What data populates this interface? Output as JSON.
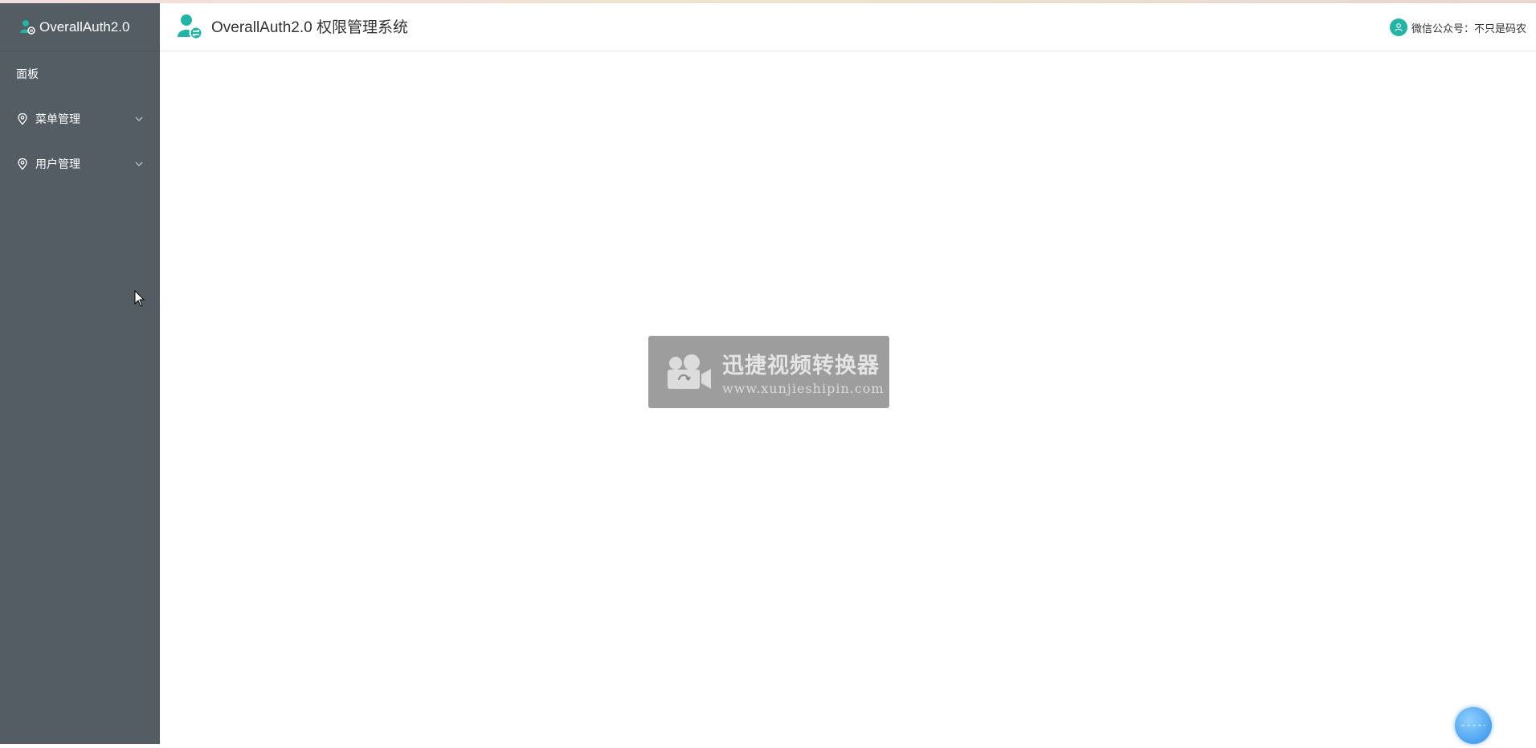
{
  "sidebar": {
    "brand": "OverallAuth2.0",
    "items": [
      {
        "label": "面板",
        "icon": "none",
        "expandable": false
      },
      {
        "label": "菜单管理",
        "icon": "location-icon",
        "expandable": true
      },
      {
        "label": "用户管理",
        "icon": "location-icon",
        "expandable": true
      }
    ]
  },
  "header": {
    "title": "OverallAuth2.0 权限管理系统",
    "user_text": "微信公众号：不只是码农"
  },
  "watermark": {
    "title": "迅捷视频转换器",
    "url": "www.xunjieshipin.com"
  },
  "colors": {
    "sidebar_bg": "#545c64",
    "accent": "#22b5a5",
    "header_bg": "#ffffff"
  }
}
